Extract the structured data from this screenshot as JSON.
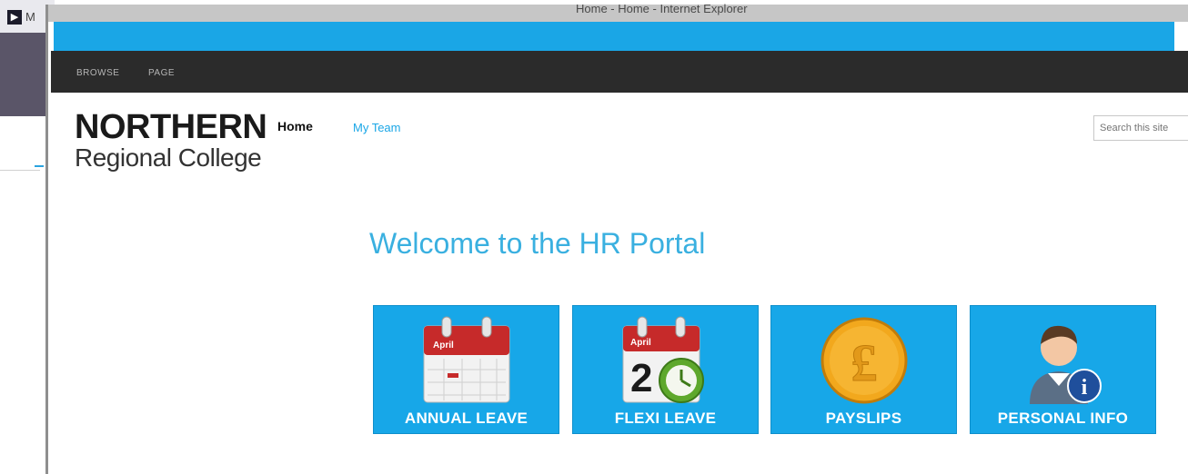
{
  "background_window": {
    "title": "M",
    "app_icon": "app-icon"
  },
  "browser": {
    "title": "Home - Home - Internet Explorer"
  },
  "ribbon": {
    "tabs": [
      "BROWSE",
      "PAGE"
    ]
  },
  "site": {
    "logo_line1": "NORTHERN",
    "logo_line2": "Regional College",
    "nav": [
      {
        "label": "Home"
      },
      {
        "label": "My Team"
      }
    ],
    "search_placeholder": "Search this site"
  },
  "main": {
    "heading": "Welcome to the HR Portal",
    "tiles": [
      {
        "label": "ANNUAL LEAVE",
        "icon": "calendar-icon",
        "icon_month": "April"
      },
      {
        "label": "FLEXI LEAVE",
        "icon": "calendar-clock-icon",
        "icon_month": "April",
        "icon_digit": "2"
      },
      {
        "label": "PAYSLIPS",
        "icon": "pound-coin-icon",
        "icon_symbol": "£"
      },
      {
        "label": "PERSONAL INFO",
        "icon": "user-info-icon",
        "icon_symbol": "i"
      }
    ]
  },
  "colors": {
    "accent_blue": "#1aa6e6",
    "ribbon_dark": "#2b2b2b",
    "tile_blue": "#17a7e8",
    "calendar_red": "#c62a2a",
    "coin_gold": "#f2a81d"
  }
}
